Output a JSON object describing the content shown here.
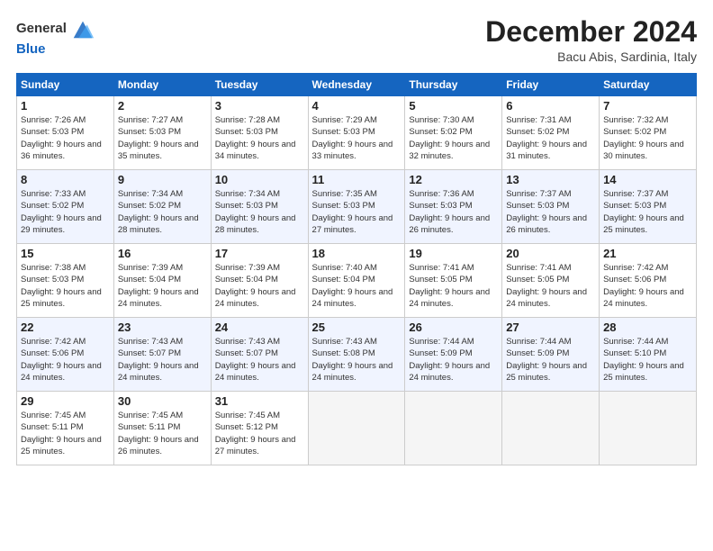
{
  "header": {
    "logo_general": "General",
    "logo_blue": "Blue",
    "month_title": "December 2024",
    "subtitle": "Bacu Abis, Sardinia, Italy"
  },
  "calendar": {
    "headers": [
      "Sunday",
      "Monday",
      "Tuesday",
      "Wednesday",
      "Thursday",
      "Friday",
      "Saturday"
    ],
    "rows": [
      [
        {
          "day": "1",
          "sunrise": "Sunrise: 7:26 AM",
          "sunset": "Sunset: 5:03 PM",
          "daylight": "Daylight: 9 hours and 36 minutes."
        },
        {
          "day": "2",
          "sunrise": "Sunrise: 7:27 AM",
          "sunset": "Sunset: 5:03 PM",
          "daylight": "Daylight: 9 hours and 35 minutes."
        },
        {
          "day": "3",
          "sunrise": "Sunrise: 7:28 AM",
          "sunset": "Sunset: 5:03 PM",
          "daylight": "Daylight: 9 hours and 34 minutes."
        },
        {
          "day": "4",
          "sunrise": "Sunrise: 7:29 AM",
          "sunset": "Sunset: 5:03 PM",
          "daylight": "Daylight: 9 hours and 33 minutes."
        },
        {
          "day": "5",
          "sunrise": "Sunrise: 7:30 AM",
          "sunset": "Sunset: 5:02 PM",
          "daylight": "Daylight: 9 hours and 32 minutes."
        },
        {
          "day": "6",
          "sunrise": "Sunrise: 7:31 AM",
          "sunset": "Sunset: 5:02 PM",
          "daylight": "Daylight: 9 hours and 31 minutes."
        },
        {
          "day": "7",
          "sunrise": "Sunrise: 7:32 AM",
          "sunset": "Sunset: 5:02 PM",
          "daylight": "Daylight: 9 hours and 30 minutes."
        }
      ],
      [
        {
          "day": "8",
          "sunrise": "Sunrise: 7:33 AM",
          "sunset": "Sunset: 5:02 PM",
          "daylight": "Daylight: 9 hours and 29 minutes."
        },
        {
          "day": "9",
          "sunrise": "Sunrise: 7:34 AM",
          "sunset": "Sunset: 5:02 PM",
          "daylight": "Daylight: 9 hours and 28 minutes."
        },
        {
          "day": "10",
          "sunrise": "Sunrise: 7:34 AM",
          "sunset": "Sunset: 5:03 PM",
          "daylight": "Daylight: 9 hours and 28 minutes."
        },
        {
          "day": "11",
          "sunrise": "Sunrise: 7:35 AM",
          "sunset": "Sunset: 5:03 PM",
          "daylight": "Daylight: 9 hours and 27 minutes."
        },
        {
          "day": "12",
          "sunrise": "Sunrise: 7:36 AM",
          "sunset": "Sunset: 5:03 PM",
          "daylight": "Daylight: 9 hours and 26 minutes."
        },
        {
          "day": "13",
          "sunrise": "Sunrise: 7:37 AM",
          "sunset": "Sunset: 5:03 PM",
          "daylight": "Daylight: 9 hours and 26 minutes."
        },
        {
          "day": "14",
          "sunrise": "Sunrise: 7:37 AM",
          "sunset": "Sunset: 5:03 PM",
          "daylight": "Daylight: 9 hours and 25 minutes."
        }
      ],
      [
        {
          "day": "15",
          "sunrise": "Sunrise: 7:38 AM",
          "sunset": "Sunset: 5:03 PM",
          "daylight": "Daylight: 9 hours and 25 minutes."
        },
        {
          "day": "16",
          "sunrise": "Sunrise: 7:39 AM",
          "sunset": "Sunset: 5:04 PM",
          "daylight": "Daylight: 9 hours and 24 minutes."
        },
        {
          "day": "17",
          "sunrise": "Sunrise: 7:39 AM",
          "sunset": "Sunset: 5:04 PM",
          "daylight": "Daylight: 9 hours and 24 minutes."
        },
        {
          "day": "18",
          "sunrise": "Sunrise: 7:40 AM",
          "sunset": "Sunset: 5:04 PM",
          "daylight": "Daylight: 9 hours and 24 minutes."
        },
        {
          "day": "19",
          "sunrise": "Sunrise: 7:41 AM",
          "sunset": "Sunset: 5:05 PM",
          "daylight": "Daylight: 9 hours and 24 minutes."
        },
        {
          "day": "20",
          "sunrise": "Sunrise: 7:41 AM",
          "sunset": "Sunset: 5:05 PM",
          "daylight": "Daylight: 9 hours and 24 minutes."
        },
        {
          "day": "21",
          "sunrise": "Sunrise: 7:42 AM",
          "sunset": "Sunset: 5:06 PM",
          "daylight": "Daylight: 9 hours and 24 minutes."
        }
      ],
      [
        {
          "day": "22",
          "sunrise": "Sunrise: 7:42 AM",
          "sunset": "Sunset: 5:06 PM",
          "daylight": "Daylight: 9 hours and 24 minutes."
        },
        {
          "day": "23",
          "sunrise": "Sunrise: 7:43 AM",
          "sunset": "Sunset: 5:07 PM",
          "daylight": "Daylight: 9 hours and 24 minutes."
        },
        {
          "day": "24",
          "sunrise": "Sunrise: 7:43 AM",
          "sunset": "Sunset: 5:07 PM",
          "daylight": "Daylight: 9 hours and 24 minutes."
        },
        {
          "day": "25",
          "sunrise": "Sunrise: 7:43 AM",
          "sunset": "Sunset: 5:08 PM",
          "daylight": "Daylight: 9 hours and 24 minutes."
        },
        {
          "day": "26",
          "sunrise": "Sunrise: 7:44 AM",
          "sunset": "Sunset: 5:09 PM",
          "daylight": "Daylight: 9 hours and 24 minutes."
        },
        {
          "day": "27",
          "sunrise": "Sunrise: 7:44 AM",
          "sunset": "Sunset: 5:09 PM",
          "daylight": "Daylight: 9 hours and 25 minutes."
        },
        {
          "day": "28",
          "sunrise": "Sunrise: 7:44 AM",
          "sunset": "Sunset: 5:10 PM",
          "daylight": "Daylight: 9 hours and 25 minutes."
        }
      ],
      [
        {
          "day": "29",
          "sunrise": "Sunrise: 7:45 AM",
          "sunset": "Sunset: 5:11 PM",
          "daylight": "Daylight: 9 hours and 25 minutes."
        },
        {
          "day": "30",
          "sunrise": "Sunrise: 7:45 AM",
          "sunset": "Sunset: 5:11 PM",
          "daylight": "Daylight: 9 hours and 26 minutes."
        },
        {
          "day": "31",
          "sunrise": "Sunrise: 7:45 AM",
          "sunset": "Sunset: 5:12 PM",
          "daylight": "Daylight: 9 hours and 27 minutes."
        },
        null,
        null,
        null,
        null
      ]
    ]
  }
}
